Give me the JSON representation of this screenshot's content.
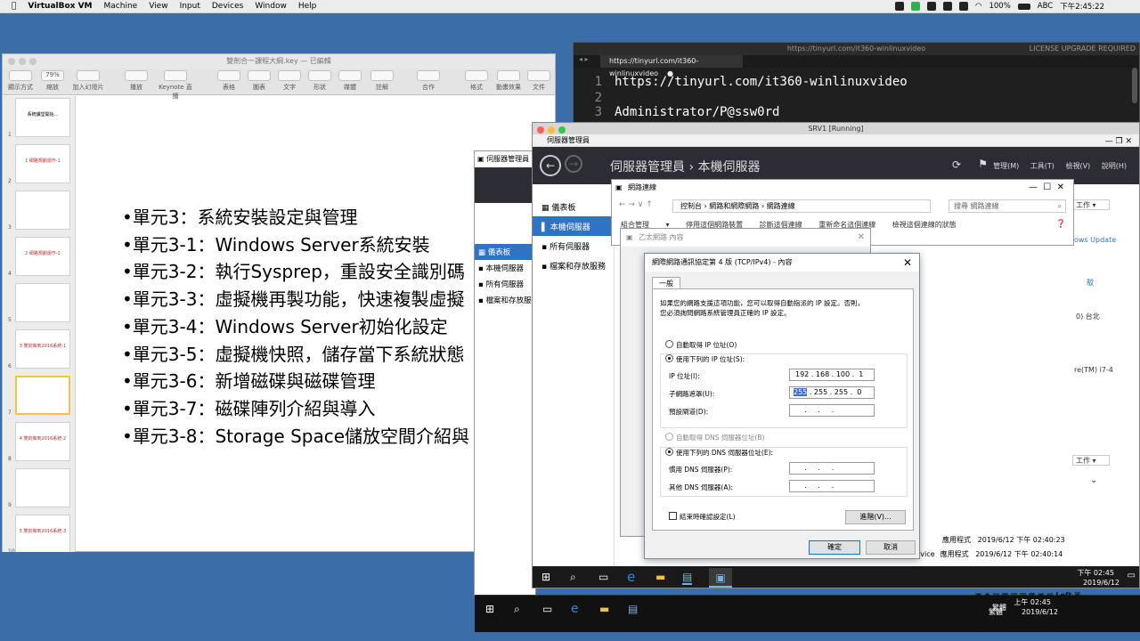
{
  "menubar": {
    "apple": "",
    "app": "VirtualBox VM",
    "items": [
      "Machine",
      "View",
      "Input",
      "Devices",
      "Window",
      "Help"
    ],
    "battery": "100%",
    "input_method": "ABC",
    "clock": "下午2:45:22"
  },
  "keynote": {
    "window_title": "雙劍合一課程大綱.key — 已編輯",
    "zoom": "79%",
    "toolbar": [
      "顯示方式",
      "縮放",
      "加入幻燈片",
      "播放",
      "Keynote 直播",
      "表格",
      "圖表",
      "文字",
      "形狀",
      "媒體",
      "註解",
      "合作",
      "格式",
      "動畫效果",
      "文件"
    ],
    "slide_numbers": [
      "1",
      "2",
      "3",
      "4",
      "5",
      "6",
      "7",
      "8",
      "9",
      "10"
    ],
    "thumbnails": [
      "系統課堂開始...",
      "1 網路規劃運作-1",
      "",
      "2 網路規劃運作-2",
      "",
      "3 雙劍做到2016系統-1",
      "",
      "4 雙劍做到2016系統-2",
      "",
      "5 雙劍做到2016系統-3"
    ],
    "bullets": [
      "•單元3：系統安裝設定與管理",
      "•單元3-1：Windows Server系統安裝",
      "•單元3-2：執行Sysprep，重設安全識別碼",
      "•單元3-3：虛擬機再製功能，快速複製虛擬",
      "•單元3-4：Windows Server初始化設定",
      "•單元3-5：虛擬機快照，儲存當下系統狀態",
      "•單元3-6：新增磁碟與磁碟管理",
      "•單元3-7：磁碟陣列介紹與導入",
      "•單元3-8：Storage Space儲放空間介紹與"
    ]
  },
  "terminal": {
    "window_url": "https://tinyurl.com/it360-winlinuxvideo",
    "license": "LICENSE UPGRADE REQUIRED",
    "tab": "https://tinyurl.com/it360-winlinuxvideo",
    "lines": [
      {
        "n": "1",
        "text": "https://tinyurl.com/it360-winlinuxvideo"
      },
      {
        "n": "2",
        "text": ""
      },
      {
        "n": "3",
        "text": "Administrator/P@ssw0rd"
      }
    ]
  },
  "server_manager_back": {
    "title": "伺服器管理員",
    "nav": [
      "儀表板",
      "本機伺服器",
      "所有伺服器",
      "檔案和存放服務"
    ]
  },
  "srv1": {
    "title": "SRV1 [Running]",
    "sm_title": "伺服器管理員",
    "breadcrumb": "伺服器管理員 › 本機伺服器",
    "menu": [
      "管理(M)",
      "工具(T)",
      "檢視(V)",
      "說明(H)"
    ],
    "nav": [
      "儀表板",
      "本機伺服器",
      "所有伺服器",
      "檔案和存放服務"
    ],
    "right": {
      "task1": "工作",
      "wu": "ows Update",
      "t1": "駁",
      "t2": "0) 台北",
      "t3": "re(TM) i7-4",
      "task2": "工作"
    },
    "events": [
      {
        "src": "應用程式",
        "time": "2019/6/12 下午 02:40:23"
      },
      {
        "src": "應用程式",
        "time": "2019/6/12 下午 02:40:14"
      }
    ],
    "service": "Service",
    "taskbar_time": "下午 02:45",
    "taskbar_date": "2019/6/12"
  },
  "network_connections": {
    "title": "網路連線",
    "path": [
      "控制台",
      "網路和網際網路",
      "網路連線"
    ],
    "search_placeholder": "搜尋 網路連線",
    "commands": [
      "組合管理 ▾",
      "停用這個網路裝置",
      "診斷這個連線",
      "重新命名這個連線",
      "檢視這個連線的狀態"
    ]
  },
  "ethernet_props": {
    "title": "乙太網路 內容"
  },
  "ipv4": {
    "title": "網際網路通訊協定第 4 版 (TCP/IPv4) - 內容",
    "tab": "一般",
    "desc": "如果您的網路支援這項功能，您可以取得自動指派的 IP 設定。否則，您必須詢問網路系統管理員正確的 IP 設定。",
    "auto_ip": "自動取得 IP 位址(O)",
    "manual_ip": "使用下列的 IP 位址(S):",
    "ip_label": "IP 位址(I):",
    "ip_value": "192 . 168 . 100 .  1",
    "mask_label": "子網路遮罩(U):",
    "mask_first": "255",
    "mask_rest": " . 255 . 255 .  0",
    "gw_label": "預設閘道(D):",
    "gw_value": "    .     .     .",
    "auto_dns": "自動取得 DNS 伺服器位址(B)",
    "manual_dns": "使用下列的 DNS 伺服器位址(E):",
    "dns1_label": "慣用 DNS 伺服器(P):",
    "dns2_label": "其他 DNS 伺服器(A):",
    "dns_value": "    .     .     .",
    "validate": "結束時確認設定(L)",
    "advanced": "進階(V)...",
    "ok": "確定",
    "cancel": "取消"
  },
  "host_taskbar": {
    "time": "上午 02:45",
    "date": "2019/6/12",
    "hostkey": "Left ⌘",
    "lang": "繁體"
  },
  "vbox_status": {
    "hostkey": "Left ⌘",
    "lang": "繁體"
  }
}
